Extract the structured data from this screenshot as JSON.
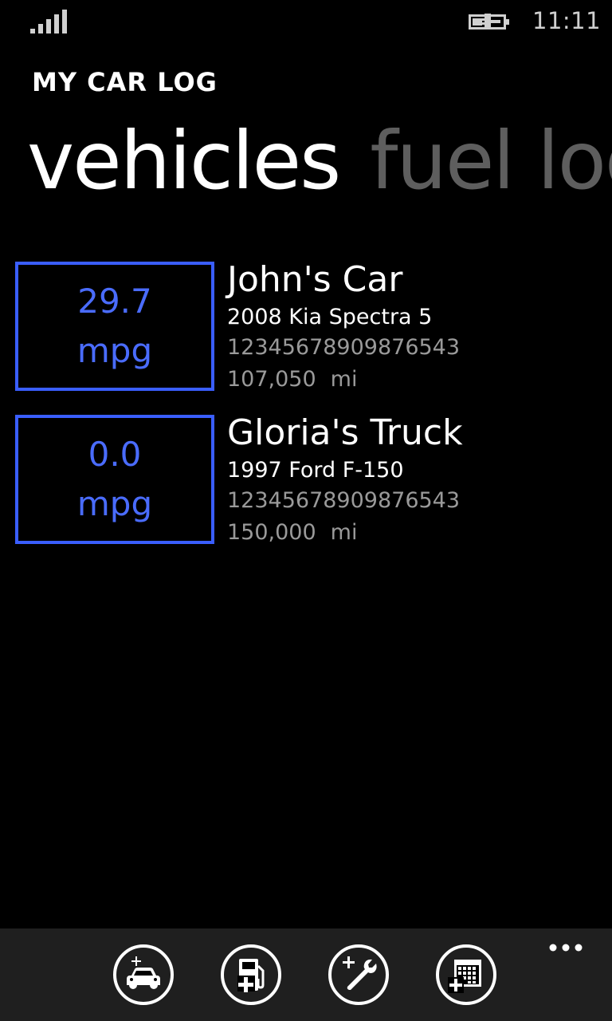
{
  "status_bar": {
    "time": "11:11",
    "signal_icon": "signal-bars-icon",
    "battery_icon": "battery-charging-icon"
  },
  "app": {
    "title": "MY CAR LOG"
  },
  "pivot": {
    "tabs": [
      {
        "label": "vehicles",
        "active": true
      },
      {
        "label": "fuel log",
        "active": false
      }
    ]
  },
  "vehicles": [
    {
      "mpg_value": "29.7",
      "mpg_unit": "mpg",
      "name": "John's Car",
      "description": "2008 Kia Spectra 5",
      "vin": "12345678909876543",
      "odometer": "107,050",
      "odometer_unit": "mi"
    },
    {
      "mpg_value": "0.0",
      "mpg_unit": "mpg",
      "name": "Gloria's Truck",
      "description": "1997 Ford F-150",
      "vin": "12345678909876543",
      "odometer": "150,000",
      "odometer_unit": "mi"
    }
  ],
  "app_bar": {
    "buttons": [
      {
        "icon": "add-vehicle-icon"
      },
      {
        "icon": "add-fuel-icon"
      },
      {
        "icon": "add-service-icon"
      },
      {
        "icon": "add-calendar-icon"
      }
    ],
    "more_icon": "more-ellipsis-icon"
  },
  "colors": {
    "accent": "#3a5eff",
    "background": "#000000",
    "app_bar_background": "#1f1f1f",
    "secondary_text": "#9a9a9a",
    "inactive_pivot": "#5e5e5e"
  }
}
